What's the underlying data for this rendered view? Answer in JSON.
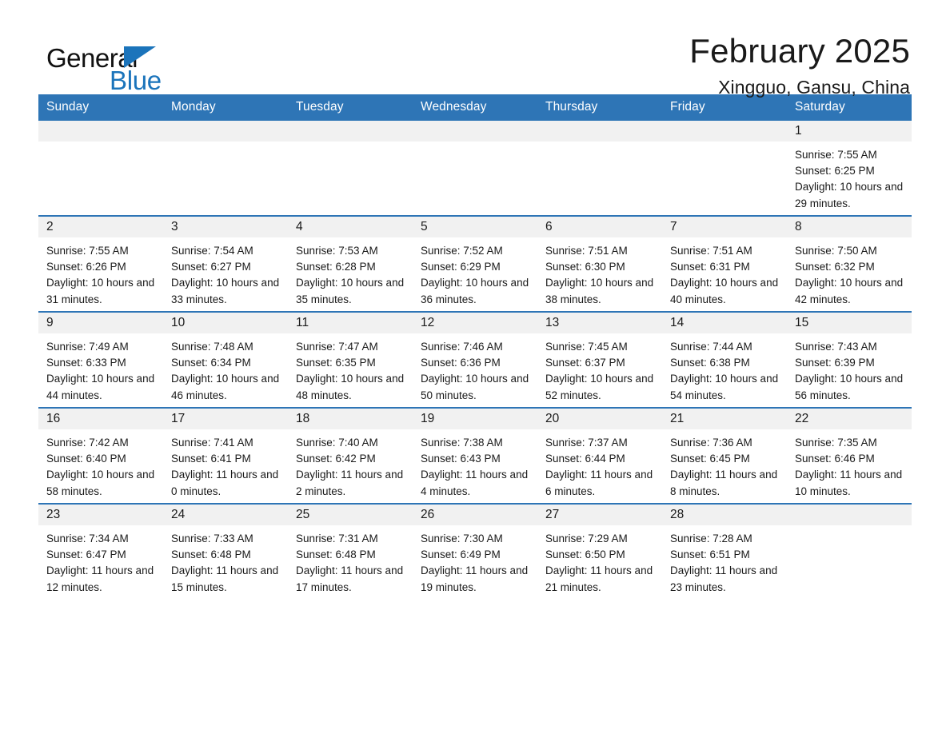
{
  "brand": {
    "name_part1": "General",
    "name_part2": "Blue",
    "accent_color": "#1b74bb"
  },
  "header": {
    "title": "February 2025",
    "subtitle": "Xingguo, Gansu, China"
  },
  "theme": {
    "header_blue": "#2e75b6",
    "daynum_band": "#f1f1f1",
    "text": "#1a1a1a"
  },
  "weekday_headers": [
    "Sunday",
    "Monday",
    "Tuesday",
    "Wednesday",
    "Thursday",
    "Friday",
    "Saturday"
  ],
  "labels": {
    "sunrise_prefix": "Sunrise: ",
    "sunset_prefix": "Sunset: ",
    "daylight_prefix": "Daylight: "
  },
  "weeks": [
    [
      {
        "day": "",
        "blank": true
      },
      {
        "day": "",
        "blank": true
      },
      {
        "day": "",
        "blank": true
      },
      {
        "day": "",
        "blank": true
      },
      {
        "day": "",
        "blank": true
      },
      {
        "day": "",
        "blank": true
      },
      {
        "day": "1",
        "sunrise": "Sunrise: 7:55 AM",
        "sunset": "Sunset: 6:25 PM",
        "daylight": "Daylight: 10 hours and 29 minutes."
      }
    ],
    [
      {
        "day": "2",
        "sunrise": "Sunrise: 7:55 AM",
        "sunset": "Sunset: 6:26 PM",
        "daylight": "Daylight: 10 hours and 31 minutes."
      },
      {
        "day": "3",
        "sunrise": "Sunrise: 7:54 AM",
        "sunset": "Sunset: 6:27 PM",
        "daylight": "Daylight: 10 hours and 33 minutes."
      },
      {
        "day": "4",
        "sunrise": "Sunrise: 7:53 AM",
        "sunset": "Sunset: 6:28 PM",
        "daylight": "Daylight: 10 hours and 35 minutes."
      },
      {
        "day": "5",
        "sunrise": "Sunrise: 7:52 AM",
        "sunset": "Sunset: 6:29 PM",
        "daylight": "Daylight: 10 hours and 36 minutes."
      },
      {
        "day": "6",
        "sunrise": "Sunrise: 7:51 AM",
        "sunset": "Sunset: 6:30 PM",
        "daylight": "Daylight: 10 hours and 38 minutes."
      },
      {
        "day": "7",
        "sunrise": "Sunrise: 7:51 AM",
        "sunset": "Sunset: 6:31 PM",
        "daylight": "Daylight: 10 hours and 40 minutes."
      },
      {
        "day": "8",
        "sunrise": "Sunrise: 7:50 AM",
        "sunset": "Sunset: 6:32 PM",
        "daylight": "Daylight: 10 hours and 42 minutes."
      }
    ],
    [
      {
        "day": "9",
        "sunrise": "Sunrise: 7:49 AM",
        "sunset": "Sunset: 6:33 PM",
        "daylight": "Daylight: 10 hours and 44 minutes."
      },
      {
        "day": "10",
        "sunrise": "Sunrise: 7:48 AM",
        "sunset": "Sunset: 6:34 PM",
        "daylight": "Daylight: 10 hours and 46 minutes."
      },
      {
        "day": "11",
        "sunrise": "Sunrise: 7:47 AM",
        "sunset": "Sunset: 6:35 PM",
        "daylight": "Daylight: 10 hours and 48 minutes."
      },
      {
        "day": "12",
        "sunrise": "Sunrise: 7:46 AM",
        "sunset": "Sunset: 6:36 PM",
        "daylight": "Daylight: 10 hours and 50 minutes."
      },
      {
        "day": "13",
        "sunrise": "Sunrise: 7:45 AM",
        "sunset": "Sunset: 6:37 PM",
        "daylight": "Daylight: 10 hours and 52 minutes."
      },
      {
        "day": "14",
        "sunrise": "Sunrise: 7:44 AM",
        "sunset": "Sunset: 6:38 PM",
        "daylight": "Daylight: 10 hours and 54 minutes."
      },
      {
        "day": "15",
        "sunrise": "Sunrise: 7:43 AM",
        "sunset": "Sunset: 6:39 PM",
        "daylight": "Daylight: 10 hours and 56 minutes."
      }
    ],
    [
      {
        "day": "16",
        "sunrise": "Sunrise: 7:42 AM",
        "sunset": "Sunset: 6:40 PM",
        "daylight": "Daylight: 10 hours and 58 minutes."
      },
      {
        "day": "17",
        "sunrise": "Sunrise: 7:41 AM",
        "sunset": "Sunset: 6:41 PM",
        "daylight": "Daylight: 11 hours and 0 minutes."
      },
      {
        "day": "18",
        "sunrise": "Sunrise: 7:40 AM",
        "sunset": "Sunset: 6:42 PM",
        "daylight": "Daylight: 11 hours and 2 minutes."
      },
      {
        "day": "19",
        "sunrise": "Sunrise: 7:38 AM",
        "sunset": "Sunset: 6:43 PM",
        "daylight": "Daylight: 11 hours and 4 minutes."
      },
      {
        "day": "20",
        "sunrise": "Sunrise: 7:37 AM",
        "sunset": "Sunset: 6:44 PM",
        "daylight": "Daylight: 11 hours and 6 minutes."
      },
      {
        "day": "21",
        "sunrise": "Sunrise: 7:36 AM",
        "sunset": "Sunset: 6:45 PM",
        "daylight": "Daylight: 11 hours and 8 minutes."
      },
      {
        "day": "22",
        "sunrise": "Sunrise: 7:35 AM",
        "sunset": "Sunset: 6:46 PM",
        "daylight": "Daylight: 11 hours and 10 minutes."
      }
    ],
    [
      {
        "day": "23",
        "sunrise": "Sunrise: 7:34 AM",
        "sunset": "Sunset: 6:47 PM",
        "daylight": "Daylight: 11 hours and 12 minutes."
      },
      {
        "day": "24",
        "sunrise": "Sunrise: 7:33 AM",
        "sunset": "Sunset: 6:48 PM",
        "daylight": "Daylight: 11 hours and 15 minutes."
      },
      {
        "day": "25",
        "sunrise": "Sunrise: 7:31 AM",
        "sunset": "Sunset: 6:48 PM",
        "daylight": "Daylight: 11 hours and 17 minutes."
      },
      {
        "day": "26",
        "sunrise": "Sunrise: 7:30 AM",
        "sunset": "Sunset: 6:49 PM",
        "daylight": "Daylight: 11 hours and 19 minutes."
      },
      {
        "day": "27",
        "sunrise": "Sunrise: 7:29 AM",
        "sunset": "Sunset: 6:50 PM",
        "daylight": "Daylight: 11 hours and 21 minutes."
      },
      {
        "day": "28",
        "sunrise": "Sunrise: 7:28 AM",
        "sunset": "Sunset: 6:51 PM",
        "daylight": "Daylight: 11 hours and 23 minutes."
      },
      {
        "day": "",
        "blank": true
      }
    ]
  ]
}
